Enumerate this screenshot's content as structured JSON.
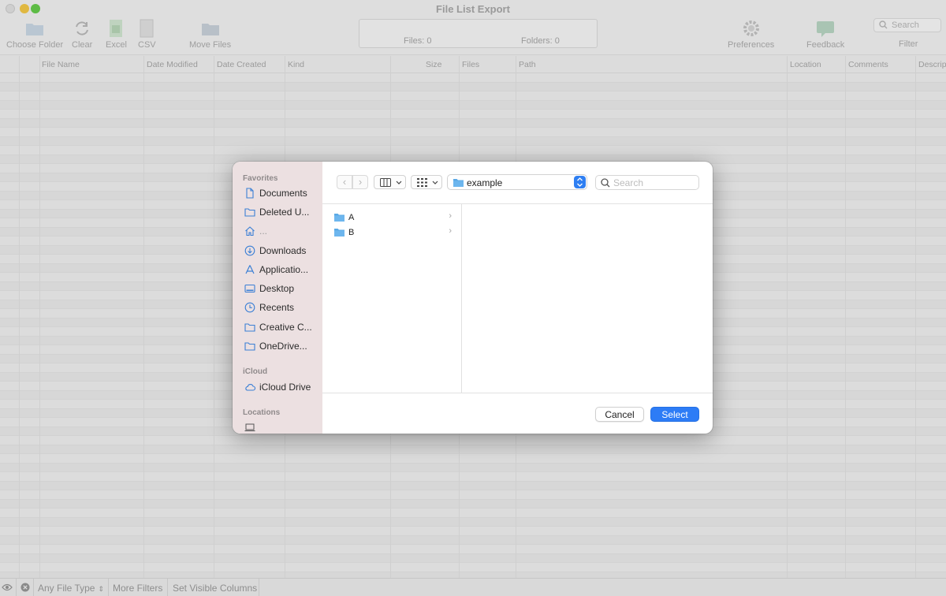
{
  "window": {
    "title": "File List Export"
  },
  "toolbar": {
    "choose_folder": "Choose Folder",
    "clear": "Clear",
    "excel": "Excel",
    "csv": "CSV",
    "move_files": "Move Files",
    "preferences": "Preferences",
    "feedback": "Feedback",
    "filter": "Filter",
    "search_placeholder": "Search"
  },
  "info": {
    "files": "Files: 0",
    "folders": "Folders: 0"
  },
  "columns": [
    "File Name",
    "Date Modified",
    "Date Created",
    "Kind",
    "Size",
    "Files",
    "Path",
    "Location",
    "Comments",
    "Descrip"
  ],
  "statusbar": {
    "file_type": "Any File Type",
    "more_filters": "More Filters",
    "set_visible_columns": "Set Visible Columns"
  },
  "dialog": {
    "sidebar": {
      "favorites_label": "Favorites",
      "favorites": [
        {
          "label": "Documents",
          "icon": "document-icon"
        },
        {
          "label": "Deleted U...",
          "icon": "folder-icon"
        },
        {
          "label": "...",
          "icon": "home-icon"
        },
        {
          "label": "Downloads",
          "icon": "download-icon"
        },
        {
          "label": "Applicatio...",
          "icon": "applications-icon"
        },
        {
          "label": "Desktop",
          "icon": "desktop-icon"
        },
        {
          "label": "Recents",
          "icon": "clock-icon"
        },
        {
          "label": "Creative C...",
          "icon": "folder-icon"
        },
        {
          "label": "OneDrive...",
          "icon": "folder-icon"
        }
      ],
      "icloud_label": "iCloud",
      "icloud_items": [
        {
          "label": "iCloud Drive",
          "icon": "cloud-icon"
        }
      ],
      "locations_label": "Locations"
    },
    "path": "example",
    "search_placeholder": "Search",
    "folders": [
      "A",
      "B"
    ],
    "cancel": "Cancel",
    "select": "Select",
    "colors": {
      "accent": "#2d7cf6",
      "folder": "#5aa9e6"
    }
  }
}
